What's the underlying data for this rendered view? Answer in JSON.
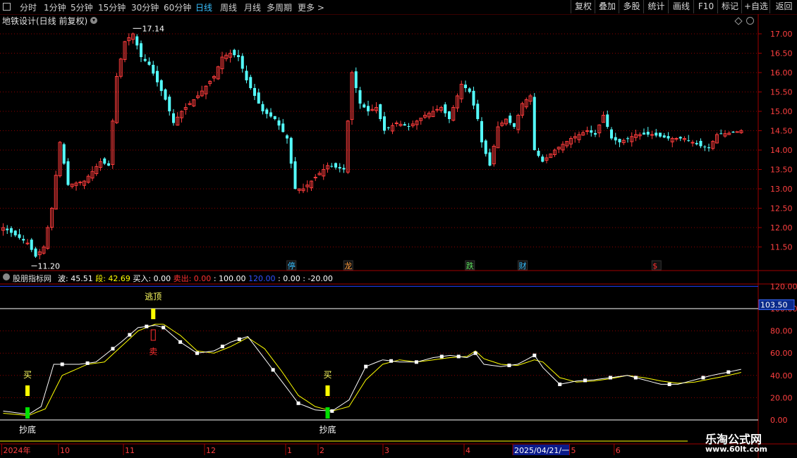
{
  "toolbar": {
    "periods": [
      "分时",
      "1分钟",
      "5分钟",
      "15分钟",
      "30分钟",
      "60分钟",
      "日线",
      "周线",
      "月线",
      "多周期",
      "更多 >"
    ],
    "active_period": "日线",
    "buttons": [
      "复权",
      "叠加",
      "多股",
      "统计",
      "画线",
      "F10",
      "标记",
      "+自选",
      "返回"
    ]
  },
  "main_chart": {
    "title": "地铁设计(日线 前复权)",
    "high_label": "17.14",
    "low_label": "11.20"
  },
  "markers": [
    {
      "text": "停",
      "color": "#39c0ff",
      "index": 71
    },
    {
      "text": "龙",
      "color": "#ff9a3c",
      "index": 85
    },
    {
      "text": "跌",
      "color": "#60e060",
      "index": 115
    },
    {
      "text": "财",
      "color": "#39c0ff",
      "index": 128
    },
    {
      "text": "$",
      "color": "#ff3030",
      "index": 161
    }
  ],
  "indicator": {
    "name": "股朋指标网",
    "values_text": [
      {
        "text": "波: 45.51",
        "color": "#ffffff"
      },
      {
        "text": "段: 42.69",
        "color": "#ffff00"
      },
      {
        "text": "买入: 0.00",
        "color": "#ffffff"
      },
      {
        "text": "卖出: 0.00",
        "color": "#ff3030"
      },
      {
        "text": ": 100.00",
        "color": "#ffffff"
      },
      {
        "text": "120.00",
        "color": "#3050ff"
      },
      {
        "text": ": 0.00",
        "color": "#ffffff"
      },
      {
        "text": ": -20.00",
        "color": "#ffffff"
      }
    ],
    "signals": [
      {
        "text": "逃顶",
        "color": "#ffff60",
        "index": 37
      },
      {
        "text": "卖",
        "color": "#ff3030",
        "index": 37
      },
      {
        "text": "买",
        "color": "#ffff60",
        "index": 6
      },
      {
        "text": "买",
        "color": "#ffff60",
        "index": 80
      },
      {
        "text": "抄底",
        "color": "#ffffff",
        "index": 6
      },
      {
        "text": "抄底",
        "color": "#ffffff",
        "index": 80
      }
    ]
  },
  "date_axis": {
    "labels": [
      "2024年",
      "10",
      "11",
      "12",
      "1",
      "2",
      "3",
      "4",
      "2025/04/21/一",
      "5",
      "6"
    ],
    "indices": [
      0,
      14,
      30,
      50,
      70,
      78,
      94,
      114,
      126,
      140,
      151
    ]
  },
  "watermark": {
    "line1": "乐淘公式网",
    "line2": "www.60lt.com"
  },
  "colors": {
    "up": "#ff3c3c",
    "down": "#54ffff",
    "wave": "#ffffff",
    "seg": "#ffff00",
    "grid": "#8b0000"
  },
  "chart_data": {
    "type": "candlestick",
    "price_axis": {
      "ticks": [
        11.5,
        12.0,
        12.5,
        13.0,
        13.5,
        14.0,
        14.5,
        15.0,
        15.5,
        16.0,
        16.5,
        17.0
      ],
      "range": [
        11.2,
        17.14
      ]
    },
    "indicator_axis": {
      "ticks": [
        0,
        20,
        40,
        60,
        80,
        100,
        120
      ],
      "highlight": 103.5,
      "range": [
        -5,
        125
      ]
    },
    "anchors": [
      [
        0,
        12.0
      ],
      [
        6,
        11.6
      ],
      [
        8,
        11.25
      ],
      [
        10,
        11.5
      ],
      [
        12,
        12.5
      ],
      [
        14,
        14.2
      ],
      [
        16,
        13.1
      ],
      [
        20,
        13.2
      ],
      [
        24,
        13.7
      ],
      [
        26,
        13.6
      ],
      [
        28,
        15.9
      ],
      [
        30,
        16.8
      ],
      [
        32,
        17.0
      ],
      [
        34,
        16.4
      ],
      [
        36,
        16.2
      ],
      [
        40,
        15.3
      ],
      [
        42,
        14.7
      ],
      [
        44,
        15.0
      ],
      [
        48,
        15.4
      ],
      [
        52,
        15.9
      ],
      [
        54,
        16.4
      ],
      [
        56,
        16.5
      ],
      [
        58,
        16.4
      ],
      [
        60,
        15.8
      ],
      [
        62,
        15.4
      ],
      [
        64,
        15.0
      ],
      [
        67,
        14.8
      ],
      [
        70,
        14.3
      ],
      [
        72,
        13.0
      ],
      [
        74,
        13.0
      ],
      [
        76,
        13.2
      ],
      [
        80,
        13.6
      ],
      [
        84,
        13.5
      ],
      [
        86,
        16.0
      ],
      [
        88,
        15.2
      ],
      [
        90,
        15.0
      ],
      [
        92,
        15.1
      ],
      [
        94,
        14.5
      ],
      [
        97,
        14.7
      ],
      [
        100,
        14.6
      ],
      [
        104,
        14.9
      ],
      [
        108,
        15.1
      ],
      [
        110,
        14.8
      ],
      [
        113,
        15.7
      ],
      [
        115,
        15.5
      ],
      [
        117,
        14.8
      ],
      [
        118,
        14.2
      ],
      [
        120,
        13.6
      ],
      [
        122,
        14.6
      ],
      [
        124,
        14.8
      ],
      [
        126,
        14.6
      ],
      [
        128,
        15.2
      ],
      [
        130,
        15.4
      ],
      [
        131,
        14.0
      ],
      [
        133,
        13.7
      ],
      [
        136,
        14.0
      ],
      [
        140,
        14.3
      ],
      [
        144,
        14.5
      ],
      [
        146,
        14.4
      ],
      [
        148,
        14.9
      ],
      [
        150,
        14.3
      ],
      [
        152,
        14.2
      ],
      [
        156,
        14.4
      ],
      [
        160,
        14.4
      ],
      [
        164,
        14.3
      ],
      [
        168,
        14.3
      ],
      [
        172,
        14.1
      ],
      [
        174,
        14.05
      ],
      [
        176,
        14.4
      ],
      [
        180,
        14.45
      ],
      [
        182,
        14.5
      ]
    ],
    "wave_anchors": [
      [
        0,
        8
      ],
      [
        6,
        5
      ],
      [
        9,
        12
      ],
      [
        12,
        50
      ],
      [
        18,
        50
      ],
      [
        22,
        52
      ],
      [
        28,
        70
      ],
      [
        32,
        83
      ],
      [
        36,
        85
      ],
      [
        38,
        83
      ],
      [
        42,
        70
      ],
      [
        46,
        60
      ],
      [
        50,
        62
      ],
      [
        54,
        70
      ],
      [
        58,
        75
      ],
      [
        62,
        55
      ],
      [
        66,
        35
      ],
      [
        70,
        15
      ],
      [
        74,
        9
      ],
      [
        78,
        8
      ],
      [
        82,
        18
      ],
      [
        86,
        48
      ],
      [
        90,
        54
      ],
      [
        94,
        52
      ],
      [
        98,
        52
      ],
      [
        102,
        56
      ],
      [
        106,
        58
      ],
      [
        110,
        56
      ],
      [
        112,
        60
      ],
      [
        114,
        50
      ],
      [
        118,
        48
      ],
      [
        122,
        50
      ],
      [
        126,
        58
      ],
      [
        128,
        47
      ],
      [
        132,
        32
      ],
      [
        136,
        35
      ],
      [
        140,
        36
      ],
      [
        144,
        38
      ],
      [
        148,
        40
      ],
      [
        152,
        36
      ],
      [
        156,
        32
      ],
      [
        160,
        32
      ],
      [
        164,
        36
      ],
      [
        168,
        40
      ],
      [
        172,
        43
      ],
      [
        175,
        45.51
      ]
    ],
    "seg_anchors": [
      [
        0,
        6
      ],
      [
        6,
        4
      ],
      [
        10,
        10
      ],
      [
        14,
        40
      ],
      [
        20,
        50
      ],
      [
        24,
        52
      ],
      [
        28,
        66
      ],
      [
        32,
        80
      ],
      [
        36,
        86
      ],
      [
        38,
        86
      ],
      [
        42,
        76
      ],
      [
        46,
        62
      ],
      [
        50,
        60
      ],
      [
        54,
        66
      ],
      [
        58,
        74
      ],
      [
        62,
        64
      ],
      [
        66,
        44
      ],
      [
        70,
        22
      ],
      [
        74,
        12
      ],
      [
        78,
        8
      ],
      [
        82,
        12
      ],
      [
        86,
        36
      ],
      [
        90,
        50
      ],
      [
        94,
        54
      ],
      [
        98,
        52
      ],
      [
        102,
        54
      ],
      [
        106,
        56
      ],
      [
        110,
        57
      ],
      [
        112,
        62
      ],
      [
        114,
        55
      ],
      [
        118,
        50
      ],
      [
        122,
        49
      ],
      [
        126,
        54
      ],
      [
        128,
        52
      ],
      [
        132,
        38
      ],
      [
        136,
        34
      ],
      [
        140,
        35
      ],
      [
        144,
        37
      ],
      [
        148,
        40
      ],
      [
        152,
        38
      ],
      [
        156,
        35
      ],
      [
        160,
        33
      ],
      [
        164,
        34
      ],
      [
        168,
        37
      ],
      [
        172,
        40
      ],
      [
        175,
        42.69
      ]
    ],
    "dot_indices": [
      14,
      20,
      26,
      30,
      34,
      38,
      42,
      46,
      52,
      56,
      64,
      70,
      78,
      86,
      92,
      98,
      104,
      108,
      112,
      120,
      126,
      132,
      138,
      144,
      150,
      158,
      166,
      172
    ]
  }
}
